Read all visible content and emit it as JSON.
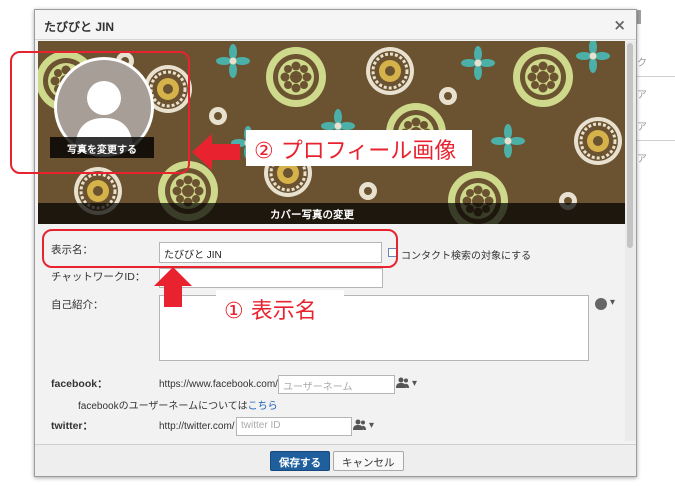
{
  "dialog": {
    "title": "たびびと JIN",
    "close_glyph": "×"
  },
  "cover": {
    "change_cover_label": "カバー写真の変更",
    "change_photo_label": "写真を変更する"
  },
  "annotations": {
    "profile_image": "② プロフィール画像",
    "display_name": "① 表示名",
    "accent_color": "#e8232f"
  },
  "form": {
    "display_name_label": "表示名：",
    "display_name_value": "たびびと JIN",
    "contact_search_label": "コンタクト検索の対象にする",
    "chatwork_id_label": "チャットワークID：",
    "self_intro_label": "自己紹介：",
    "facebook_label": "facebook：",
    "facebook_prefix": "https://www.facebook.com/",
    "facebook_placeholder": "ユーザーネーム",
    "facebook_hint": "facebookのユーザーネームについては",
    "facebook_hint_link": "こちら",
    "twitter_label": "twitter：",
    "twitter_prefix": "http://twitter.com/",
    "twitter_placeholder": "twitter ID",
    "privacy_caret": "▾"
  },
  "footer": {
    "save_label": "保存する",
    "cancel_label": "キャンセル"
  },
  "backdrop": {
    "right_letters": [
      "ク",
      "ア",
      "ア",
      "ア"
    ]
  },
  "colors": {
    "primary_button": "#1f5f9e",
    "link": "#1a5fb4",
    "cover_background": "#6b5331"
  }
}
